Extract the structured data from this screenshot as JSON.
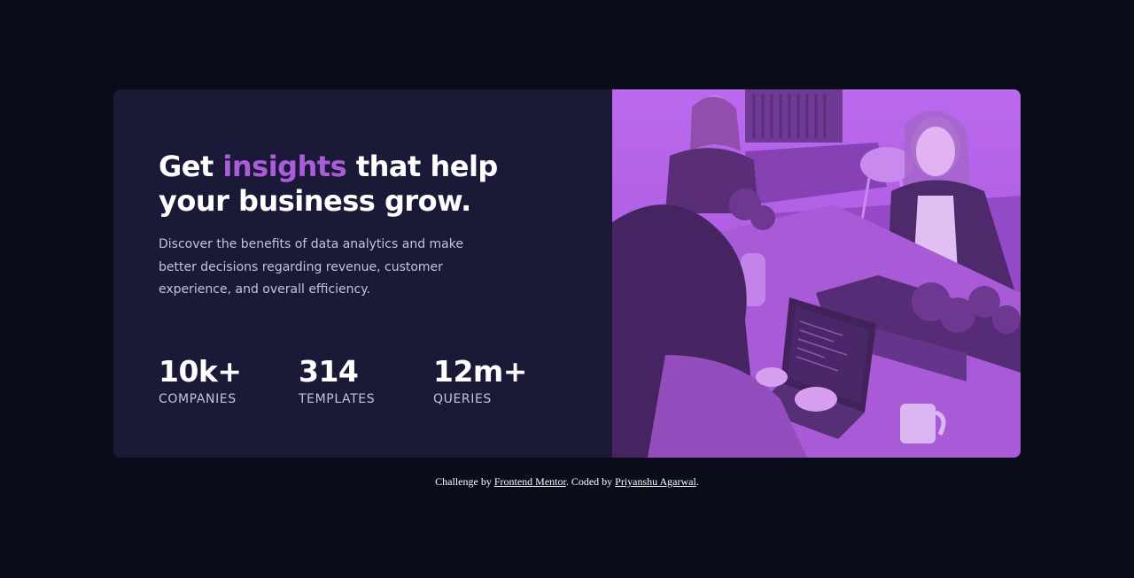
{
  "card": {
    "headline": {
      "before": "Get",
      "accent": "insights",
      "after": "that help your business grow."
    },
    "description": "Discover the benefits of data analytics and make better decisions regarding revenue, customer experience, and overall efficiency.",
    "stats": [
      {
        "value": "10k+",
        "label": "Companies"
      },
      {
        "value": "314",
        "label": "Templates"
      },
      {
        "value": "12m+",
        "label": "Queries"
      }
    ],
    "image": {
      "icon": "office-team-photo",
      "tint": "#aa5cdb"
    }
  },
  "colors": {
    "page_bg": "#0a0c1a",
    "card_bg": "#1b1938",
    "accent": "#ab5cdb",
    "text_muted": "#c5c3d6"
  },
  "attribution": {
    "prefix": "Challenge by",
    "link1": "Frontend Mentor",
    "middle": ". Coded by",
    "link2": "Priyanshu Agarwal",
    "suffix": "."
  }
}
